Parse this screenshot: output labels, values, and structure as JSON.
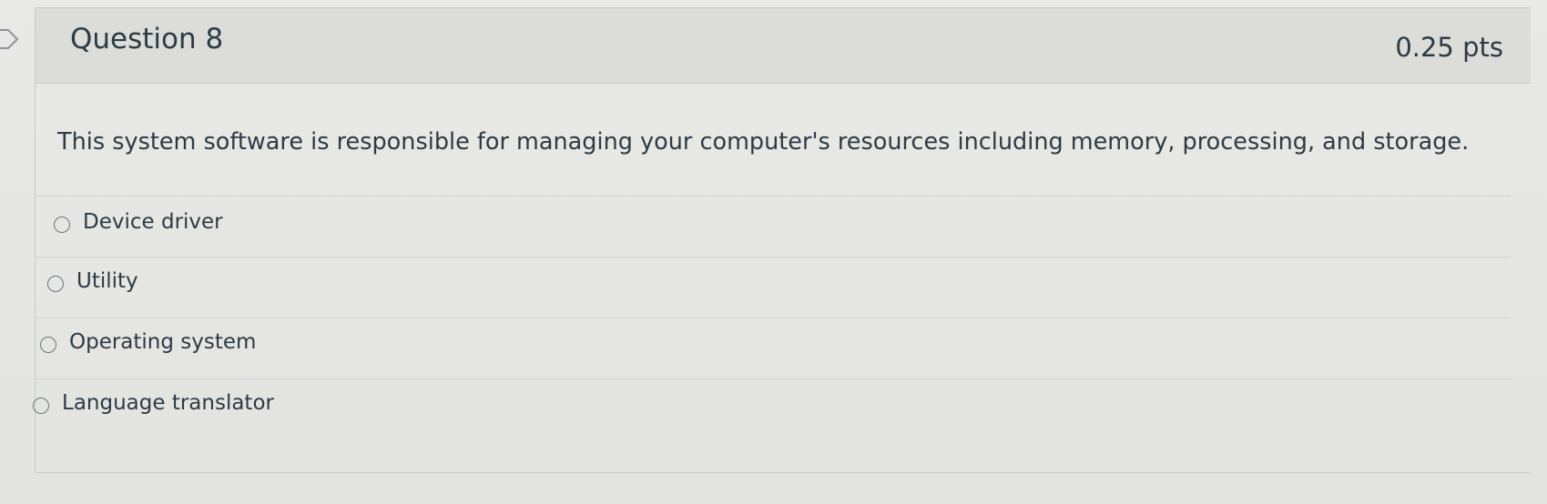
{
  "question": {
    "title": "Question 8",
    "points": "0.25 pts",
    "text": "This system software is responsible for managing your computer's resources including memory, processing, and storage.",
    "answers": [
      {
        "label": "Device driver",
        "selected": false
      },
      {
        "label": "Utility",
        "selected": false
      },
      {
        "label": "Operating system",
        "selected": false
      },
      {
        "label": "Language translator",
        "selected": false
      }
    ]
  },
  "colors": {
    "text": "#2d3b45",
    "header_bg": "#dcdcd9",
    "border": "#c7cdd1"
  },
  "icons": {
    "flag": "flag-outline-icon"
  }
}
